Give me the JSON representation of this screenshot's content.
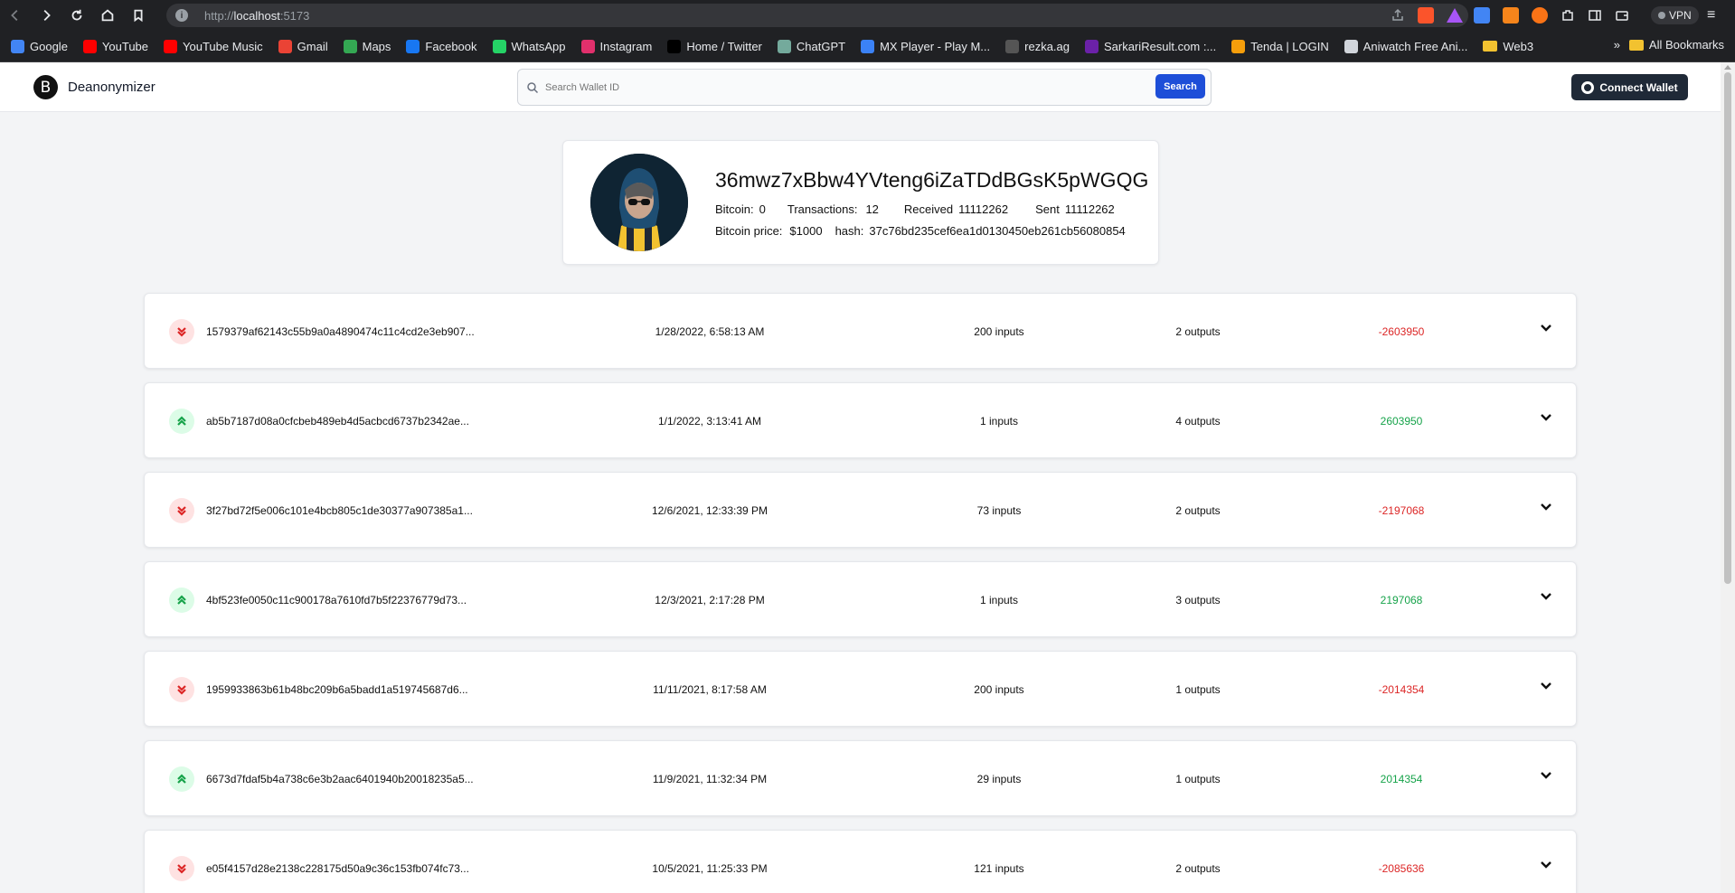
{
  "browser": {
    "url_prefix": "http://",
    "url_host": "localhost",
    "url_port": ":5173",
    "vpn_label": "VPN",
    "bookmarks": [
      {
        "label": "Google",
        "icon": "google-icon",
        "color": "#4285f4"
      },
      {
        "label": "YouTube",
        "icon": "youtube-icon",
        "color": "#ff0000"
      },
      {
        "label": "YouTube Music",
        "icon": "youtube-music-icon",
        "color": "#ff0000"
      },
      {
        "label": "Gmail",
        "icon": "gmail-icon",
        "color": "#ea4335"
      },
      {
        "label": "Maps",
        "icon": "maps-icon",
        "color": "#34a853"
      },
      {
        "label": "Facebook",
        "icon": "facebook-icon",
        "color": "#1877f2"
      },
      {
        "label": "WhatsApp",
        "icon": "whatsapp-icon",
        "color": "#25d366"
      },
      {
        "label": "Instagram",
        "icon": "instagram-icon",
        "color": "#e1306c"
      },
      {
        "label": "Home / Twitter",
        "icon": "x-icon",
        "color": "#000000"
      },
      {
        "label": "ChatGPT",
        "icon": "chatgpt-icon",
        "color": "#74aa9c"
      },
      {
        "label": "MX Player - Play M...",
        "icon": "mx-player-icon",
        "color": "#3b82f6"
      },
      {
        "label": "rezka.ag",
        "icon": "rezka-icon",
        "color": "#555555"
      },
      {
        "label": "SarkariResult.com :...",
        "icon": "sarkari-icon",
        "color": "#6b21a8"
      },
      {
        "label": "Tenda | LOGIN",
        "icon": "tenda-icon",
        "color": "#f59e0b"
      },
      {
        "label": "Aniwatch Free Ani...",
        "icon": "aniwatch-icon",
        "color": "#d1d5db"
      },
      {
        "label": "Web3",
        "icon": "folder-icon",
        "color": "#f2c230"
      }
    ],
    "all_bookmarks": "All Bookmarks"
  },
  "app": {
    "logo_letter": "B",
    "brand": "Deanonymizer",
    "search_placeholder": "Search Wallet ID",
    "search_button": "Search",
    "connect_button": "Connect Wallet"
  },
  "profile": {
    "wallet_id": "36mwz7xBbw4YVteng6iZaTDdBGsK5pWGQG",
    "bitcoin_label": "Bitcoin:",
    "bitcoin_value": "0",
    "transactions_label": "Transactions:",
    "transactions_value": "12",
    "received_label": "Received",
    "received_value": "11112262",
    "sent_label": "Sent",
    "sent_value": "11112262",
    "price_label": "Bitcoin price:",
    "price_value": "$1000",
    "hash_label": "hash:",
    "hash_value": "37c76bd235cef6ea1d0130450eb261cb56080854"
  },
  "transactions": [
    {
      "direction": "out",
      "hash": "1579379af62143c55b9a0a4890474c11c4cd2e3eb907...",
      "date": "1/28/2022, 6:58:13 AM",
      "inputs": "200 inputs",
      "outputs": "2 outputs",
      "amount": "-2603950"
    },
    {
      "direction": "in",
      "hash": "ab5b7187d08a0cfcbeb489eb4d5acbcd6737b2342ae...",
      "date": "1/1/2022, 3:13:41 AM",
      "inputs": "1 inputs",
      "outputs": "4 outputs",
      "amount": "2603950"
    },
    {
      "direction": "out",
      "hash": "3f27bd72f5e006c101e4bcb805c1de30377a907385a1...",
      "date": "12/6/2021, 12:33:39 PM",
      "inputs": "73 inputs",
      "outputs": "2 outputs",
      "amount": "-2197068"
    },
    {
      "direction": "in",
      "hash": "4bf523fe0050c11c900178a7610fd7b5f22376779d73...",
      "date": "12/3/2021, 2:17:28 PM",
      "inputs": "1 inputs",
      "outputs": "3 outputs",
      "amount": "2197068"
    },
    {
      "direction": "out",
      "hash": "1959933863b61b48bc209b6a5badd1a519745687d6...",
      "date": "11/11/2021, 8:17:58 AM",
      "inputs": "200 inputs",
      "outputs": "1 outputs",
      "amount": "-2014354"
    },
    {
      "direction": "in",
      "hash": "6673d7fdaf5b4a738c6e3b2aac6401940b20018235a5...",
      "date": "11/9/2021, 11:32:34 PM",
      "inputs": "29 inputs",
      "outputs": "1 outputs",
      "amount": "2014354"
    },
    {
      "direction": "out",
      "hash": "e05f4157d28e2138c228175d50a9c36c153fb074fc73...",
      "date": "10/5/2021, 11:25:33 PM",
      "inputs": "121 inputs",
      "outputs": "2 outputs",
      "amount": "-2085636"
    }
  ],
  "colors": {
    "outgoing": "#dc2626",
    "incoming": "#16a34a",
    "primary_button": "#1d4ed8",
    "dark_button": "#1f2937"
  }
}
